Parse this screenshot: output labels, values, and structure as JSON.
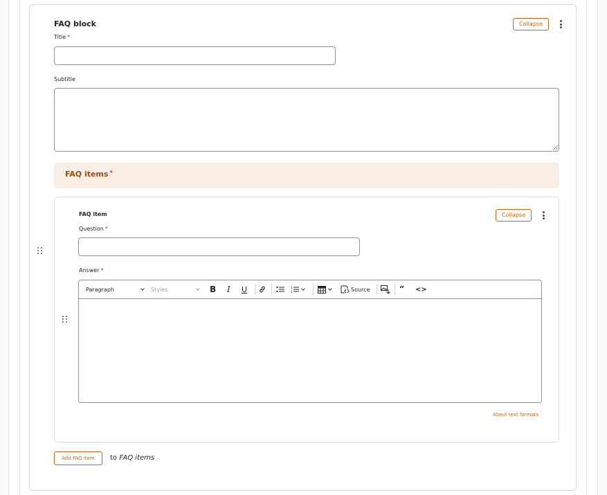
{
  "block": {
    "title": "FAQ block",
    "collapse_label": "Collapse",
    "title_field": {
      "label": "Title",
      "required_mark": "*",
      "value": ""
    },
    "subtitle_field": {
      "label": "Subtitle",
      "value": ""
    }
  },
  "faq_items": {
    "header": "FAQ items",
    "required_mark": "*",
    "item": {
      "title": "FAQ item",
      "collapse_label": "Collapse",
      "question": {
        "label": "Question",
        "required_mark": "*",
        "value": ""
      },
      "answer": {
        "label": "Answer",
        "required_mark": "*",
        "toolbar": {
          "paragraph": "Paragraph",
          "styles": "Styles",
          "source": "Source"
        },
        "content": ""
      },
      "about_link": "About text formats"
    },
    "add_button": "Add FAQ item",
    "add_to_prefix": "to",
    "add_to_target": "FAQ items"
  },
  "colors": {
    "accent": "#c8670e",
    "required": "#d72222",
    "faq_header_bg": "#f9eee4",
    "faq_header_text": "#9c4f0a"
  }
}
